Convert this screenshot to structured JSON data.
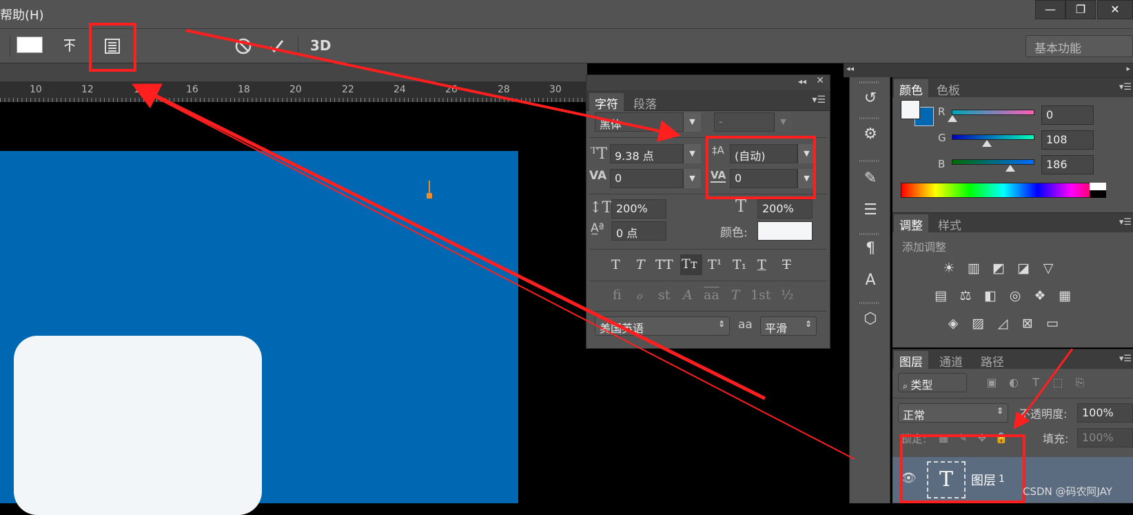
{
  "menubar": {
    "help_label": "帮助(H)"
  },
  "window_controls": {
    "minimize": "—",
    "restore": "❐",
    "close": "✕"
  },
  "toolbar": {
    "icons": [
      "color-swatch",
      "warp-text-icon",
      "character-panel-toggle-icon",
      "cancel-icon",
      "commit-icon",
      "3d-icon"
    ],
    "icon_3d": "3D",
    "workspace_label": "基本功能"
  },
  "ruler": {
    "ticks": [
      "10",
      "12",
      "14",
      "16",
      "18",
      "20",
      "22",
      "24",
      "26",
      "28",
      "30"
    ]
  },
  "character_panel": {
    "tabs": [
      "字符",
      "段落"
    ],
    "font_family": "黑体",
    "font_style": "-",
    "font_size": "9.38 点",
    "leading": "(自动)",
    "kerning": "0",
    "tracking": "0",
    "vertical_scale": "200%",
    "horizontal_scale": "200%",
    "baseline_shift": "0 点",
    "color_label": "颜色:",
    "color_value": "#f4f6f8",
    "style_buttons": [
      "T",
      "T",
      "TT",
      "Tт",
      "T¹",
      "T₁",
      "T",
      "T"
    ],
    "opentype_buttons": [
      "fi",
      "ℴ",
      "st",
      "A",
      "aa",
      "T",
      "1st",
      "½"
    ],
    "language": "美国英语",
    "aa_label": "aa",
    "antialias": "平滑"
  },
  "color_panel": {
    "tabs": [
      "颜色",
      "色板"
    ],
    "channels": [
      {
        "label": "R",
        "value": "0"
      },
      {
        "label": "G",
        "value": "108"
      },
      {
        "label": "B",
        "value": "186"
      }
    ],
    "foreground": "#f4f6f8",
    "background": "#0067b2"
  },
  "adjust_panel": {
    "tabs": [
      "调整",
      "样式"
    ],
    "hint": "添加调整"
  },
  "layers_panel": {
    "tabs": [
      "图层",
      "通道",
      "路径"
    ],
    "filter_label": "类型",
    "blend_mode": "正常",
    "opacity_label": "不透明度:",
    "opacity_value": "100%",
    "lock_label": "锁定:",
    "fill_label": "填充:",
    "fill_value": "100%",
    "layer_name": "图层",
    "layer_number": "1"
  },
  "watermark": "CSDN @码农阿JAY",
  "accent_colors": {
    "highlight": "#ff1f1f",
    "canvas_blue": "#0067b2"
  }
}
